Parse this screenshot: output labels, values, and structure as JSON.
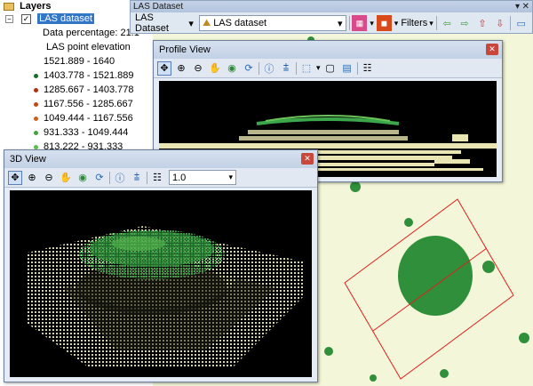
{
  "toc": {
    "layers_label": "Layers",
    "dataset_label": "LAS dataset",
    "data_percentage": "Data percentage: 21.1",
    "elevation_label": "LAS point elevation",
    "ranges": [
      {
        "label": "1521.889 - 1640",
        "color": "#ffffff"
      },
      {
        "label": "1403.778 - 1521.889",
        "color": "#1a6b2a"
      },
      {
        "label": "1285.667 - 1403.778",
        "color": "#b03010"
      },
      {
        "label": "1167.556 - 1285.667",
        "color": "#c04818"
      },
      {
        "label": "1049.444 - 1167.556",
        "color": "#d06020"
      },
      {
        "label": "931.333 - 1049.444",
        "color": "#4aa040"
      },
      {
        "label": "813.222 - 931.333",
        "color": "#5cc050"
      }
    ]
  },
  "las_toolbar": {
    "title": "LAS Dataset",
    "dataset_dropdown": "LAS Dataset",
    "layer_dropdown": "LAS dataset",
    "filters_label": "Filters"
  },
  "profile_view": {
    "title": "Profile View"
  },
  "view3d": {
    "title": "3D View",
    "exaggeration": "1.0"
  },
  "colors": {
    "point_green": "#2f8f3a",
    "point_cream": "#e9e6b4",
    "rect_red": "#e02020"
  }
}
